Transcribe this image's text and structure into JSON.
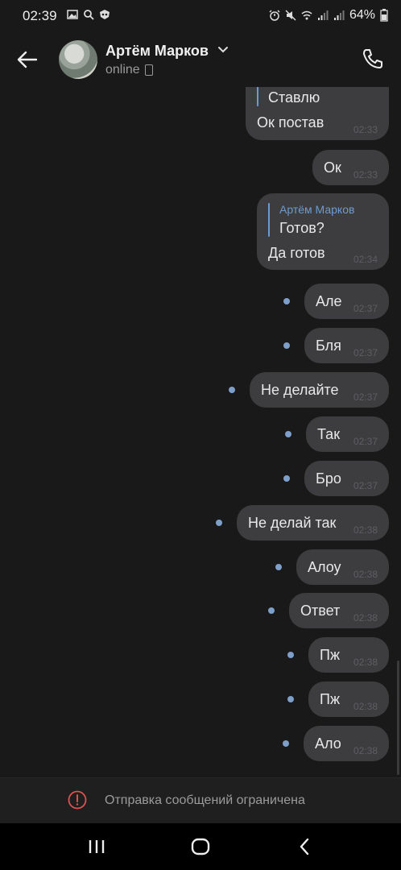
{
  "status_bar": {
    "time": "02:39",
    "left_icons": [
      "gallery-icon",
      "search-icon",
      "vpn-icon"
    ],
    "right_icons": [
      "alarm-icon",
      "mute-icon",
      "wifi-icon",
      "signal-icon",
      "signal-icon"
    ],
    "battery": "64%"
  },
  "header": {
    "name": "Артём Марков",
    "status": "online"
  },
  "messages": [
    {
      "text": "Ок постав",
      "time": "02:33",
      "reply_text": "Ставлю"
    },
    {
      "text": "Ок",
      "time": "02:33"
    },
    {
      "text": "Да готов",
      "time": "02:34",
      "reply_author": "Артём Марков",
      "reply_text": "Готов?"
    },
    {
      "text": "Але",
      "time": "02:37",
      "unread": true
    },
    {
      "text": "Бля",
      "time": "02:37",
      "unread": true
    },
    {
      "text": "Не делайте",
      "time": "02:37",
      "unread": true
    },
    {
      "text": "Так",
      "time": "02:37",
      "unread": true
    },
    {
      "text": "Бро",
      "time": "02:37",
      "unread": true
    },
    {
      "text": "Не делай так",
      "time": "02:38",
      "unread": true
    },
    {
      "text": "Алоу",
      "time": "02:38",
      "unread": true
    },
    {
      "text": "Ответ",
      "time": "02:38",
      "unread": true
    },
    {
      "text": "Пж",
      "time": "02:38",
      "unread": true
    },
    {
      "text": "Пж",
      "time": "02:38",
      "unread": true
    },
    {
      "text": "Ало",
      "time": "02:38",
      "unread": true
    }
  ],
  "restricted_banner": {
    "text": "Отправка сообщений ограничена",
    "color": "#e05050"
  },
  "colors": {
    "background": "#191919",
    "bubble": "#3d3d3f",
    "accent": "#6c9bd2"
  }
}
